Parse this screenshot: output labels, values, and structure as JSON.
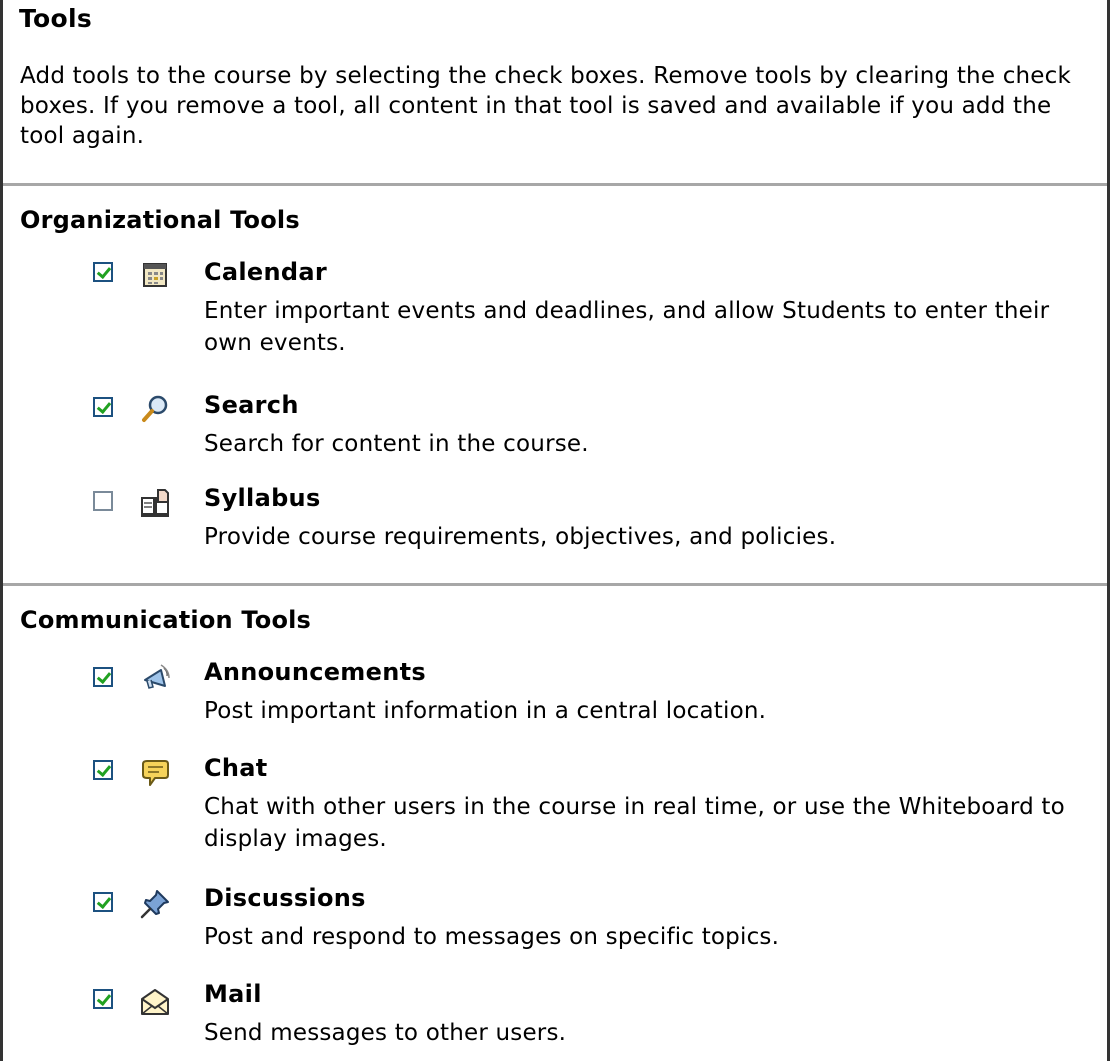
{
  "title": "Tools",
  "intro": "Add tools to the course by selecting the check boxes. Remove tools by clearing the check boxes. If you remove a tool, all content in that tool is saved and available if you add the tool again.",
  "colors": {
    "checkbox_border": "#1c5180",
    "checkmark": "#21a121",
    "divider": "#a7a7a7"
  },
  "organizational": {
    "heading": "Organizational Tools",
    "tools": [
      {
        "name": "Calendar",
        "description": "Enter important events and deadlines, and allow Students to enter their own events.",
        "checked": true,
        "icon": "calendar-icon"
      },
      {
        "name": "Search",
        "description": "Search for content in the course.",
        "checked": true,
        "icon": "search-icon"
      },
      {
        "name": "Syllabus",
        "description": "Provide course requirements, objectives, and policies.",
        "checked": false,
        "icon": "syllabus-icon"
      }
    ]
  },
  "communication": {
    "heading": "Communication Tools",
    "tools": [
      {
        "name": "Announcements",
        "description": "Post important information in a central location.",
        "checked": true,
        "icon": "megaphone-icon"
      },
      {
        "name": "Chat",
        "description": "Chat with other users in the course in real time, or use the Whiteboard to display images.",
        "checked": true,
        "icon": "chat-bubble-icon"
      },
      {
        "name": "Discussions",
        "description": "Post and respond to messages on specific topics.",
        "checked": true,
        "icon": "pushpin-icon"
      },
      {
        "name": "Mail",
        "description": "Send messages to other users.",
        "checked": true,
        "icon": "envelope-icon"
      }
    ]
  }
}
